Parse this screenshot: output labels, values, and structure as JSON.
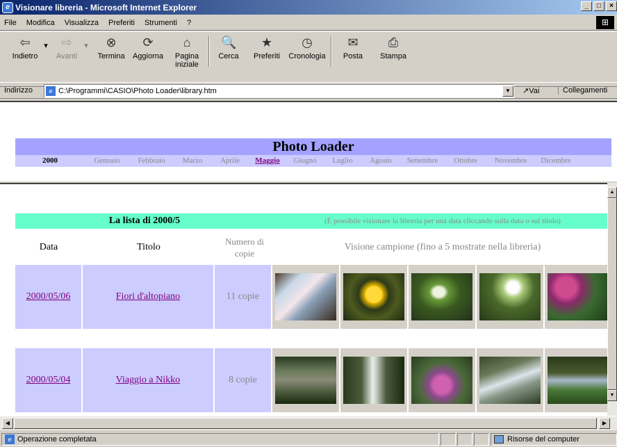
{
  "window": {
    "title": "Visionare libreria - Microsoft Internet Explorer",
    "controls": [
      "_",
      "8",
      "x"
    ]
  },
  "menu": [
    "File",
    "Modifica",
    "Visualizza",
    "Preferiti",
    "Strumenti",
    "?"
  ],
  "toolbar": {
    "back": "Indietro",
    "forward": "Avanti",
    "stop": "Termina",
    "refresh": "Aggiorna",
    "home_line1": "Pagina",
    "home_line2": "iniziale",
    "search": "Cerca",
    "favorites": "Preferiti",
    "history": "Cronologia",
    "mail": "Posta",
    "print": "Stampa"
  },
  "address": {
    "label": "Indirizzo",
    "url": "C:\\Programmi\\CASIO\\Photo Loader\\library.htm",
    "go": "Vai",
    "links": "Collegamenti"
  },
  "header": {
    "title": "Photo Loader",
    "year": "2000",
    "months": [
      "Gennaio",
      "Febbraio",
      "Marzo",
      "Aprile",
      "Maggio",
      "Giugno",
      "Luglio",
      "Agosto",
      "Settembre",
      "Ottobre",
      "Novembre",
      "Dicembre"
    ],
    "active_month": "Maggio"
  },
  "list": {
    "title": "La lista di 2000/5",
    "hint": "(È possibile visionare la libreria per una data cliccando sulla data o sul titolo)",
    "columns": {
      "date": "Data",
      "title": "Titolo",
      "count_line1": "Numero di",
      "count_line2": "copie",
      "preview": "Visione campione (fino a 5 mostrate nella libreria)"
    },
    "rows": [
      {
        "date": "2000/05/06",
        "title": "Fiori d'altopiano",
        "count": "11 copie"
      },
      {
        "date": "2000/05/04",
        "title": "Viaggio a Nikko",
        "count": "8 copie"
      }
    ]
  },
  "status": {
    "text": "Operazione completata",
    "zone": "Risorse del computer"
  }
}
